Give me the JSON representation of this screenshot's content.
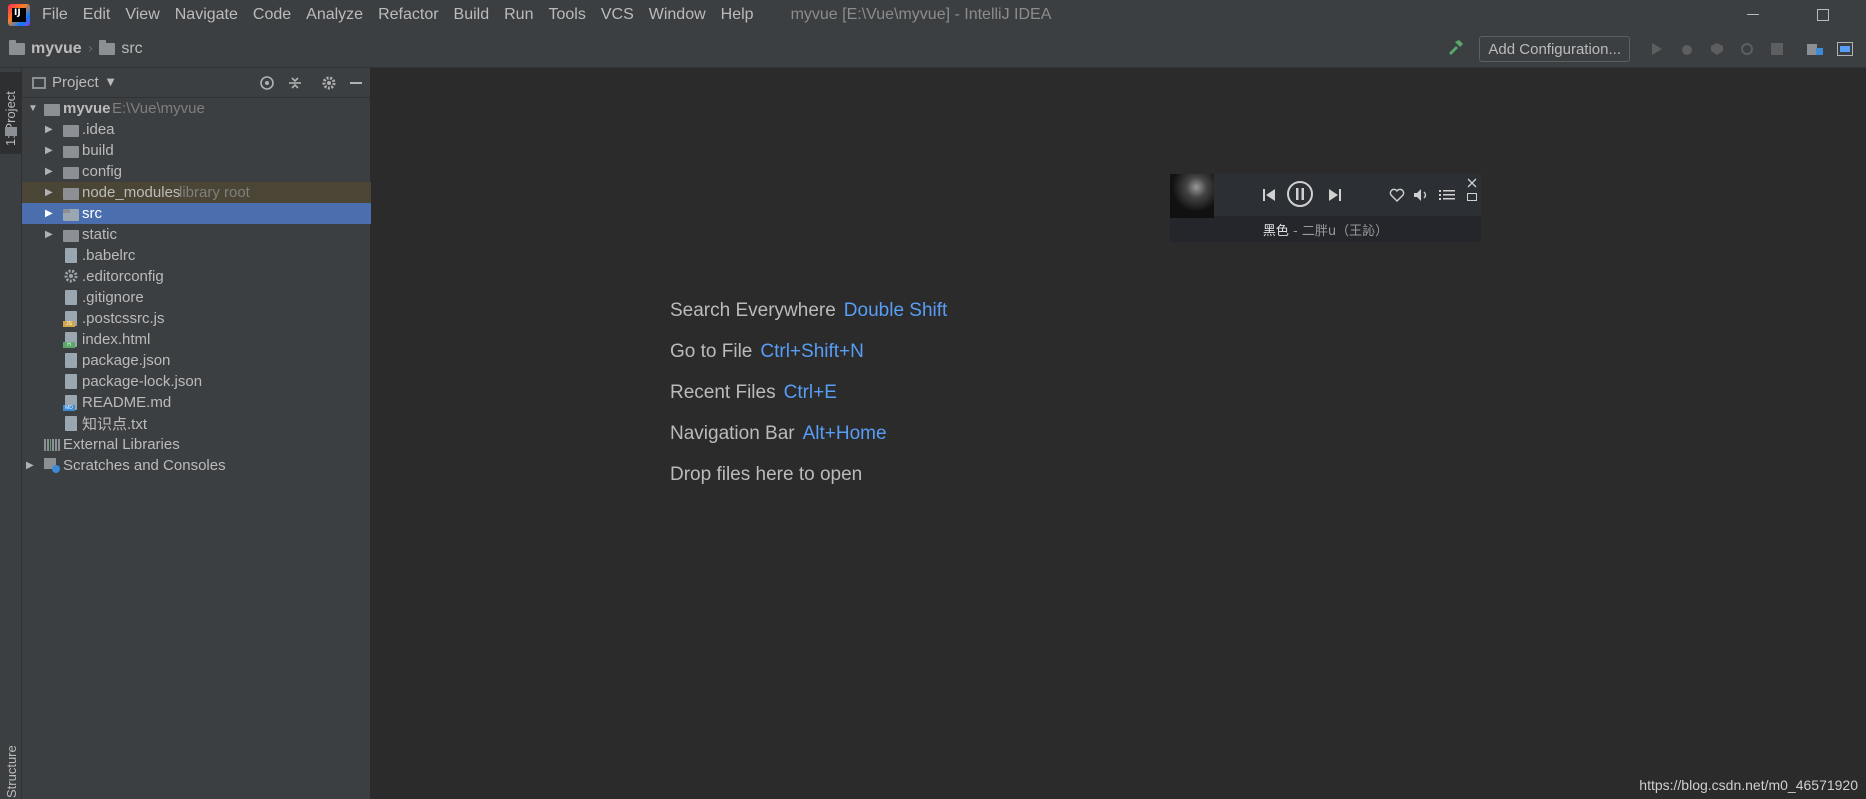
{
  "menubar": {
    "items": [
      "File",
      "Edit",
      "View",
      "Navigate",
      "Code",
      "Analyze",
      "Refactor",
      "Build",
      "Run",
      "Tools",
      "VCS",
      "Window",
      "Help"
    ],
    "window_title": "myvue [E:\\Vue\\myvue] - IntelliJ IDEA"
  },
  "navbar": {
    "crumbs": [
      "myvue",
      "src"
    ],
    "add_configuration": "Add Configuration..."
  },
  "sidebar": {
    "project_tab": "1: Project",
    "structure_tab": "Structure"
  },
  "project_panel": {
    "title": "Project",
    "root": {
      "name": "myvue",
      "path": "E:\\Vue\\myvue"
    },
    "items": [
      {
        "label": "myvue",
        "extra": "E:\\Vue\\myvue"
      },
      {
        "label": ".idea"
      },
      {
        "label": "build"
      },
      {
        "label": "config"
      },
      {
        "label": "node_modules",
        "extra": "library root"
      },
      {
        "label": "src"
      },
      {
        "label": "static"
      },
      {
        "label": ".babelrc"
      },
      {
        "label": ".editorconfig"
      },
      {
        "label": ".gitignore"
      },
      {
        "label": ".postcssrc.js"
      },
      {
        "label": "index.html"
      },
      {
        "label": "package.json"
      },
      {
        "label": "package-lock.json"
      },
      {
        "label": "README.md"
      },
      {
        "label": "知识点.txt"
      },
      {
        "label": "External Libraries"
      },
      {
        "label": "Scratches and Consoles"
      }
    ]
  },
  "editor": {
    "hints": [
      {
        "label": "Search Everywhere",
        "shortcut": "Double Shift"
      },
      {
        "label": "Go to File",
        "shortcut": "Ctrl+Shift+N"
      },
      {
        "label": "Recent Files",
        "shortcut": "Ctrl+E"
      },
      {
        "label": "Navigation Bar",
        "shortcut": "Alt+Home"
      },
      {
        "label": "Drop files here to open",
        "shortcut": ""
      }
    ]
  },
  "music_player": {
    "title": "黑色",
    "artist": " - 二胖u（王訫）"
  },
  "watermark": "https://blog.csdn.net/m0_46571920",
  "colors": {
    "selected_row": "#4b6eaf",
    "shortcut": "#589df6",
    "library_root_row": "#4a4535"
  }
}
